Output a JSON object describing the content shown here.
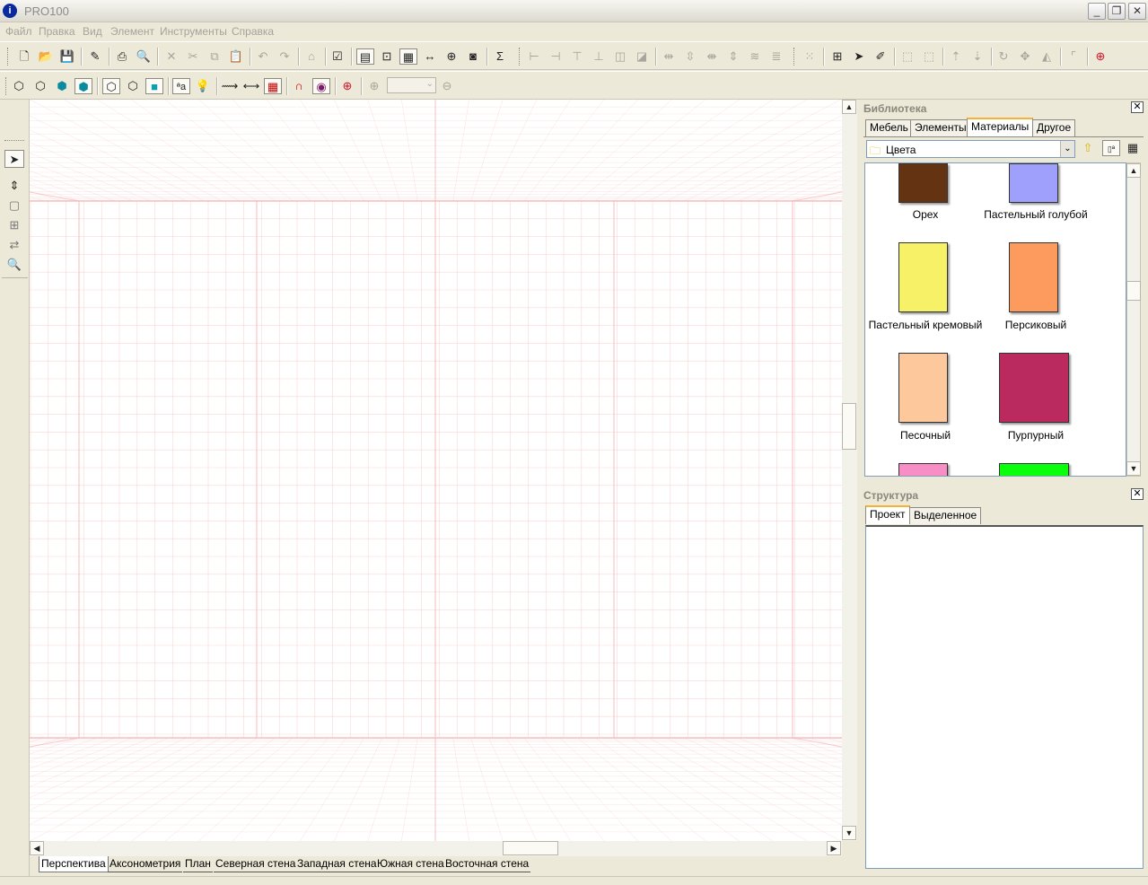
{
  "window": {
    "title": "PRO100"
  },
  "menu": [
    "Файл",
    "Правка",
    "Вид",
    "Элемент",
    "Инструменты",
    "Справка"
  ],
  "library": {
    "title": "Библиотека",
    "tabs": [
      "Мебель",
      "Элементы",
      "Материалы",
      "Другое"
    ],
    "active_tab": "Материалы",
    "folder": "Цвета",
    "items": [
      {
        "label": "Орех",
        "color": "#643412"
      },
      {
        "label": "Пастельный голубой",
        "color": "#9fa0fb"
      },
      {
        "label": "Пастельный кремовый",
        "color": "#f7f168"
      },
      {
        "label": "Персиковый",
        "color": "#fd9b5f"
      },
      {
        "label": "Песочный",
        "color": "#fdc99c"
      },
      {
        "label": "Пурпурный",
        "color": "#bb2a5f"
      },
      {
        "label": "",
        "color": "#f78fc6"
      },
      {
        "label": "",
        "color": "#0aff0c"
      }
    ]
  },
  "structure": {
    "title": "Структура",
    "tabs": [
      "Проект",
      "Выделенное"
    ],
    "active_tab": "Проект"
  },
  "view_tabs": [
    "Перспектива",
    "Аксонометрия",
    "План",
    "Северная стена",
    "Западная стена",
    "Южная стена",
    "Восточная стена"
  ],
  "active_view": "Перспектива",
  "grid_color": "#f4b8b8"
}
